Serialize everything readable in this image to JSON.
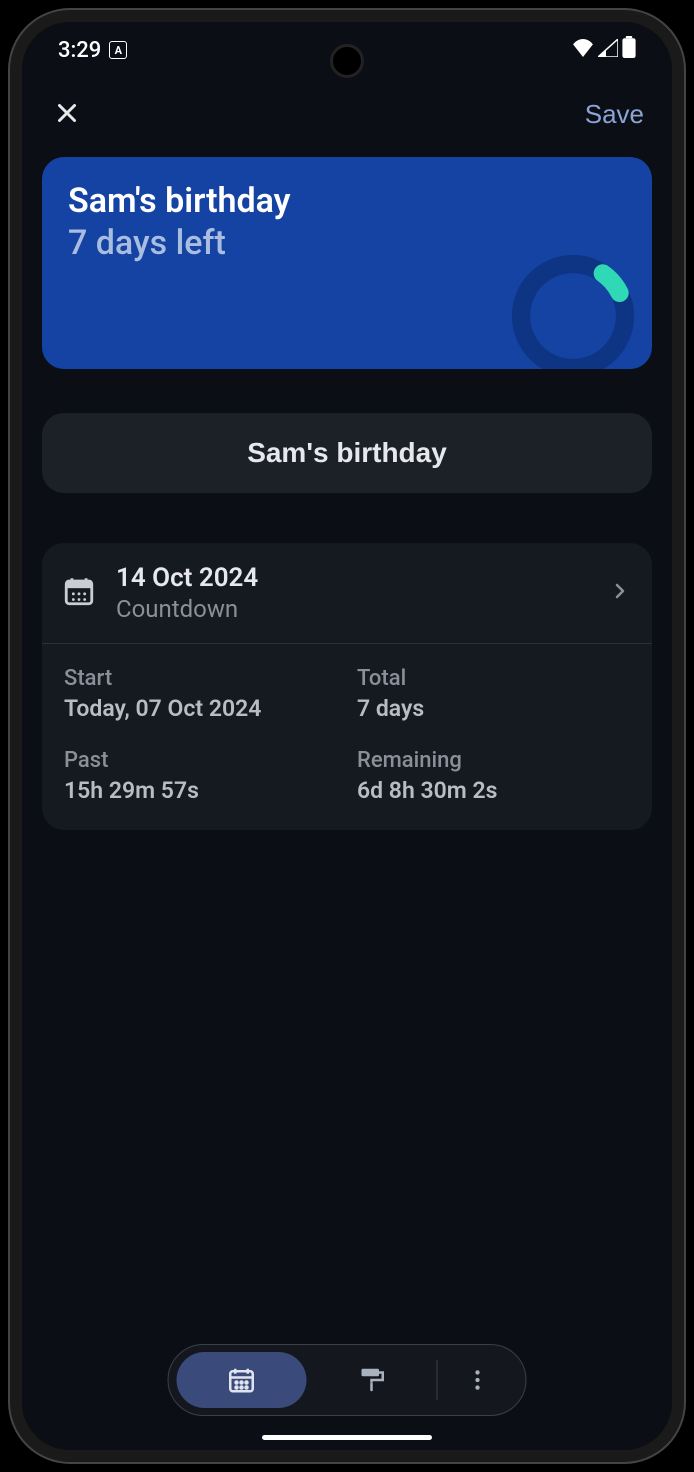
{
  "status": {
    "time": "3:29",
    "badge": "A"
  },
  "header": {
    "save_label": "Save"
  },
  "preview": {
    "title": "Sam's birthday",
    "subtitle": "7 days left",
    "accent_color": "#1443a3",
    "ring_color": "#2fd9b5"
  },
  "name_field": {
    "value": "Sam's birthday"
  },
  "date_row": {
    "date": "14 Oct 2024",
    "mode": "Countdown"
  },
  "stats": {
    "start_label": "Start",
    "start_value": "Today, 07 Oct 2024",
    "total_label": "Total",
    "total_value": "7 days",
    "past_label": "Past",
    "past_value": "15h 29m 57s",
    "remaining_label": "Remaining",
    "remaining_value": "6d 8h 30m 2s"
  },
  "dock": {
    "active_tab": "calendar"
  }
}
